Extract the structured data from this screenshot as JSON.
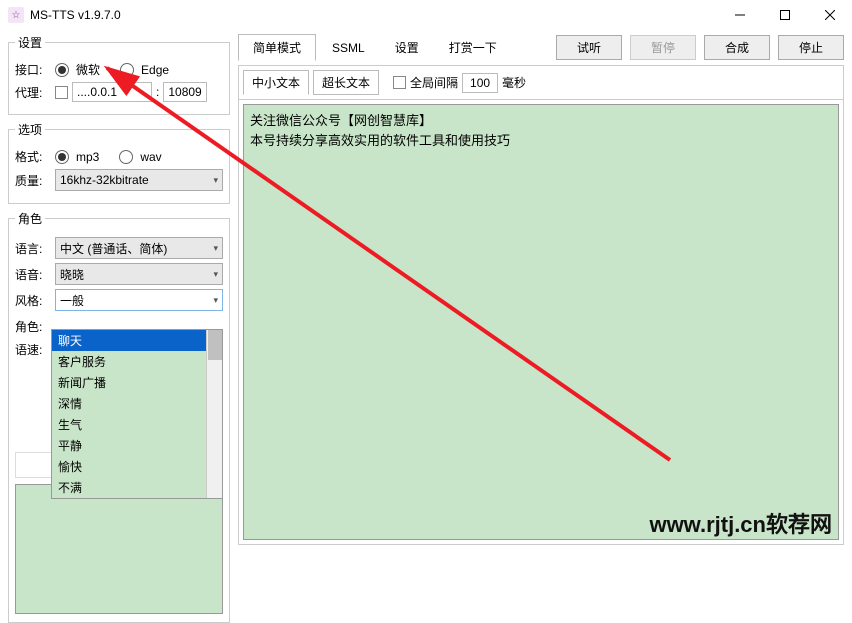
{
  "window": {
    "title": "MS-TTS v1.9.7.0",
    "icon_name": "app-icon"
  },
  "sections": {
    "settings": "设置",
    "options": "选项",
    "role": "角色"
  },
  "interface": {
    "label": "接口:",
    "microsoft": "微软",
    "edge": "Edge",
    "proxy_label": "代理:",
    "proxy_host": "....0.0.1",
    "proxy_port": "10809"
  },
  "options": {
    "format_label": "格式:",
    "mp3": "mp3",
    "wav": "wav",
    "quality_label": "质量:",
    "quality_value": "16khz-32kbitrate"
  },
  "role": {
    "lang_label": "语言:",
    "lang_value": "中文 (普通话、简体)",
    "voice_label": "语音:",
    "voice_value": "晓晓",
    "style_label": "风格:",
    "style_value": "一般",
    "style_options": [
      "聊天",
      "客户服务",
      "新闻广播",
      "深情",
      "生气",
      "平静",
      "愉快",
      "不满"
    ],
    "char_label": "角色:",
    "speed_label": "语速:"
  },
  "tabs": {
    "simple": "简单模式",
    "ssml": "SSML",
    "settings": "设置",
    "reward": "打赏一下"
  },
  "buttons": {
    "preview": "试听",
    "pause": "暂停",
    "synth": "合成",
    "stop": "停止"
  },
  "subtabs": {
    "short": "中小文本",
    "long": "超长文本",
    "global_gap": "全局间隔",
    "gap_value": "100",
    "ms": "毫秒"
  },
  "text": {
    "line1": "关注微信公众号【网创智慧库】",
    "line2": "本号持续分享高效实用的软件工具和使用技巧"
  },
  "watermark": "www.rjtj.cn软荐网"
}
